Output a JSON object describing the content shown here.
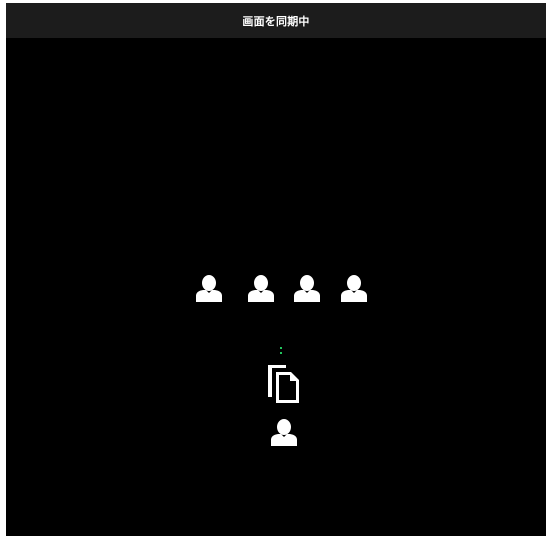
{
  "title_bar": {
    "title": "画面を同期中"
  },
  "participants": [
    {
      "icon": "person-icon"
    },
    {
      "icon": "person-icon"
    },
    {
      "icon": "person-icon"
    },
    {
      "icon": "person-icon"
    }
  ],
  "presenter": {
    "icon": "person-icon",
    "shared_icon": "copy-document-icon"
  },
  "colors": {
    "background": "#000000",
    "title_bar": "#1c1c1c",
    "icon": "#ffffff",
    "sync_indicator": "#22c55e"
  }
}
